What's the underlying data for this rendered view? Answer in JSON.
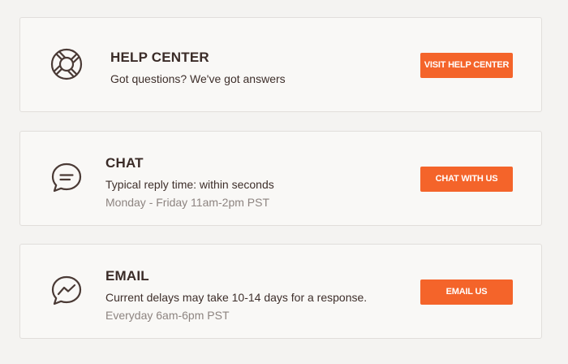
{
  "cards": {
    "help": {
      "icon": "lifebuoy-icon",
      "title": "HELP CENTER",
      "description": "Got questions? We've got answers",
      "button_label": "VISIT HELP CENTER"
    },
    "chat": {
      "icon": "chat-bubble-icon",
      "title": "CHAT",
      "description": "Typical reply time: within seconds",
      "hours": "Monday - Friday 11am-2pm PST",
      "button_label": "CHAT WITH US"
    },
    "email": {
      "icon": "messenger-icon",
      "title": "EMAIL",
      "description": "Current delays may take 10-14 days for a response.",
      "hours": "Everyday 6am-6pm PST",
      "button_label": "EMAIL US"
    }
  },
  "colors": {
    "accent": "#f4642a",
    "text": "#3a2b27",
    "muted": "#8d8480",
    "background": "#f4f3f1",
    "card": "#f9f8f6"
  }
}
